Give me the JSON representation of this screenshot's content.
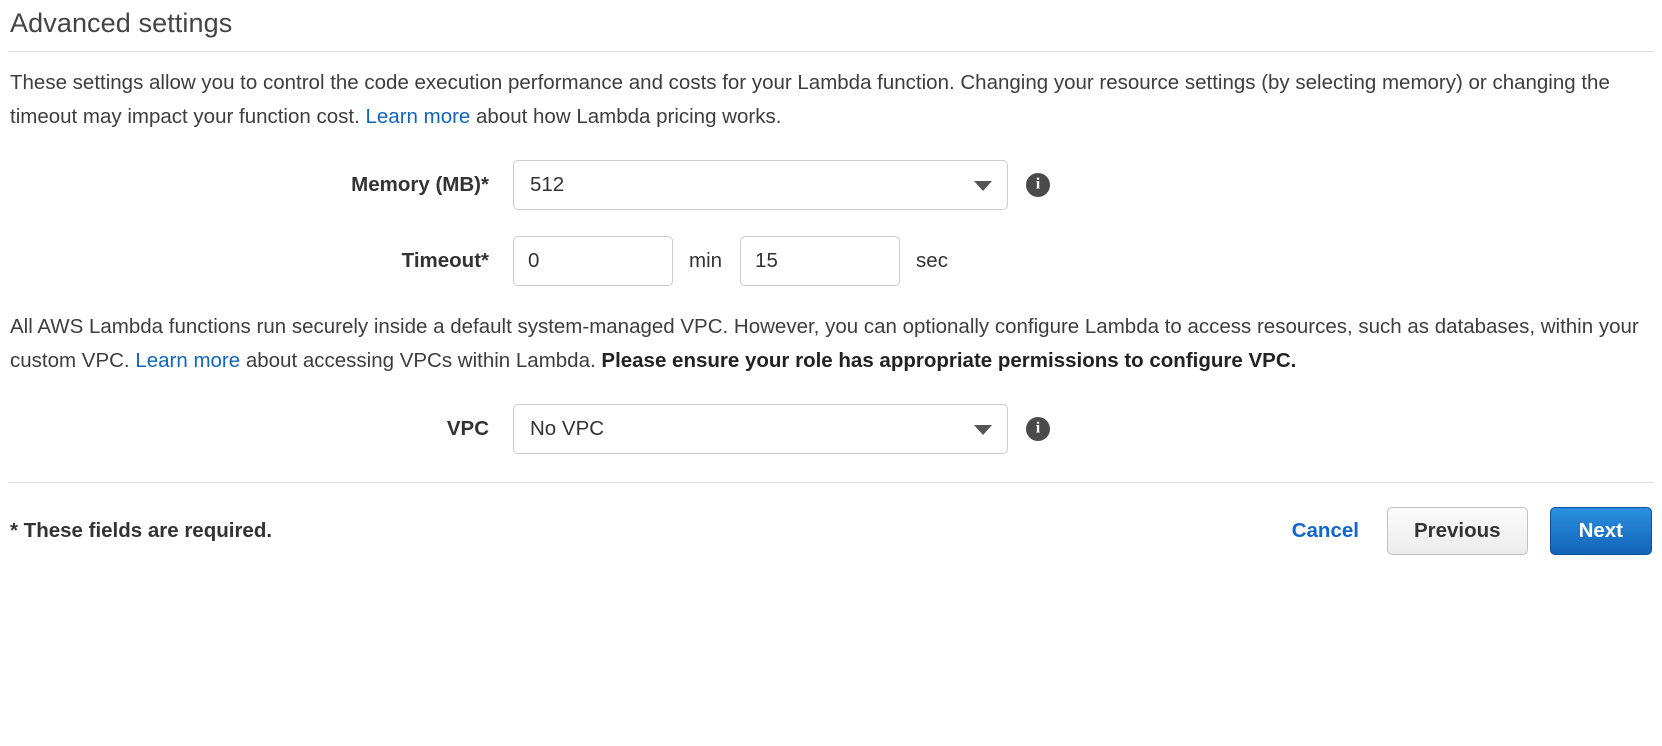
{
  "section": {
    "title": "Advanced settings",
    "intro_part1": "These settings allow you to control the code execution performance and costs for your Lambda function. Changing your resource settings (by selecting memory) or changing the timeout may impact your function cost. ",
    "intro_link": "Learn more",
    "intro_part2": " about how Lambda pricing works."
  },
  "fields": {
    "memory": {
      "label": "Memory (MB)*",
      "value": "512",
      "caret_icon": "chevron-down-icon",
      "info_icon": "info-icon",
      "info_glyph": "i"
    },
    "timeout": {
      "label": "Timeout*",
      "minutes_value": "0",
      "minutes_unit": "min",
      "seconds_value": "15",
      "seconds_unit": "sec"
    },
    "vpc": {
      "label": "VPC",
      "value": "No VPC",
      "caret_icon": "chevron-down-icon",
      "info_icon": "info-icon",
      "info_glyph": "i"
    }
  },
  "vpc_note": {
    "part1": "All AWS Lambda functions run securely inside a default system-managed VPC. However, you can optionally configure Lambda to access resources, such as databases, within your custom VPC. ",
    "link": "Learn more",
    "part2": " about accessing VPCs within Lambda. ",
    "bold": "Please ensure your role has appropriate permissions to configure VPC."
  },
  "footer": {
    "required_note": "* These fields are required.",
    "cancel_label": "Cancel",
    "previous_label": "Previous",
    "next_label": "Next"
  },
  "colors": {
    "link_blue": "#1166bb",
    "primary_button": "#1f7fd4",
    "text": "#333333",
    "border": "#cccccc",
    "rule": "#dddddd"
  }
}
